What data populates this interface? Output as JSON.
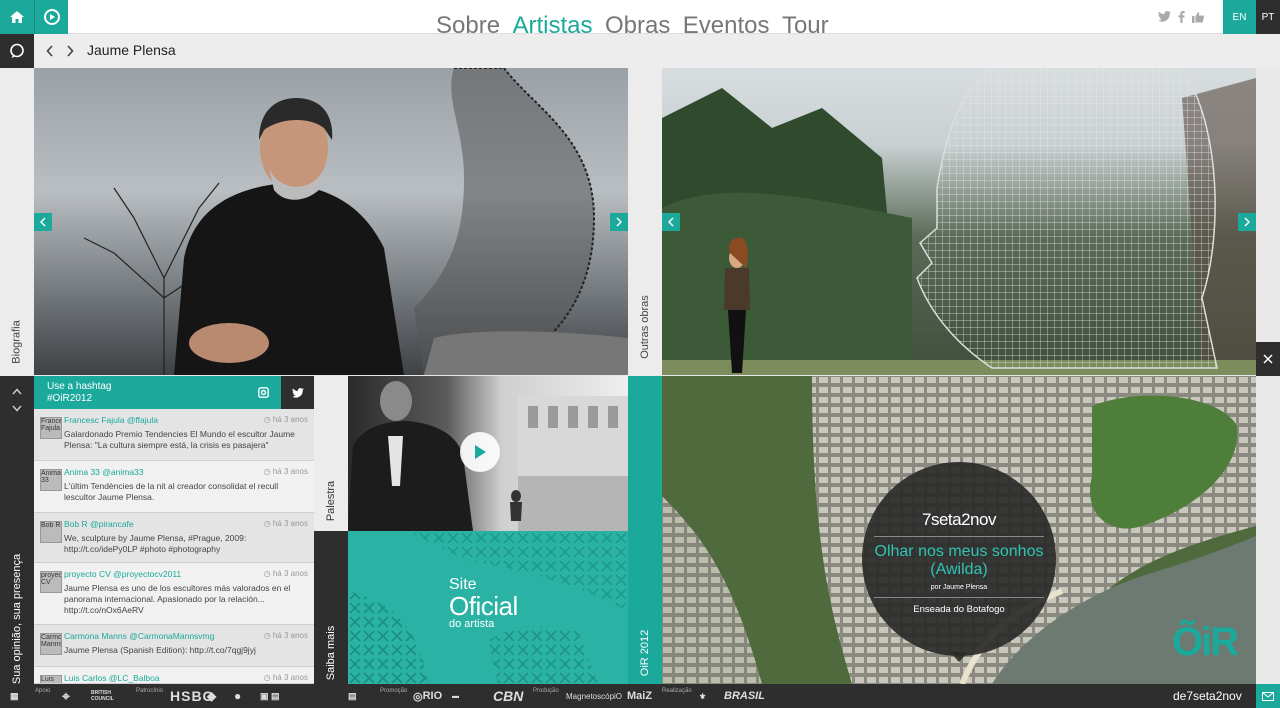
{
  "colors": {
    "accent": "#1aa99a",
    "dark": "#2e2e2e"
  },
  "topbar": {
    "home_icon": "home-icon",
    "play_icon": "play-icon",
    "nav": [
      {
        "label": "Sobre"
      },
      {
        "label": "Artistas",
        "active": true
      },
      {
        "label": "Obras"
      },
      {
        "label": "Eventos"
      },
      {
        "label": "Tour"
      }
    ],
    "social": [
      "twitter-icon",
      "facebook-icon",
      "like-icon"
    ],
    "lang": [
      "EN",
      "PT"
    ]
  },
  "subbar": {
    "title": "Jaume Plensa"
  },
  "sidetabs": {
    "biografia": "Biografia",
    "outras_obras": "Outras obras",
    "opiniao": "Sua opinião, sua presença",
    "palestra": "Palestra",
    "saiba_mais": "Saiba mais",
    "oir": "OiR 2012"
  },
  "hashtag": {
    "line1": "Use a hashtag",
    "line2": "#OiR2012"
  },
  "tweets": [
    {
      "avatar": "Francesc Fajula",
      "user": "Francesc Fajula @ffajula",
      "time": "há 3 anos",
      "text": "Galardonado Premio Tendencies El Mundo el escultor Jaume Plensa: \"La cultura siempre está, la crisis es pasajera\""
    },
    {
      "avatar": "Anima 33",
      "user": "Anima 33 @anima33",
      "time": "há 3 anos",
      "text": "L'últim Tendències de la nit al creador consolidat el recull lescultor Jaume Plensa."
    },
    {
      "avatar": "Bob R",
      "user": "Bob R @pirancafe",
      "time": "há 3 anos",
      "text": "We, sculpture by Jaume Plensa, #Prague, 2009: http://t.co/idePy0LP #photo #photography"
    },
    {
      "avatar": "proyecto CV",
      "user": "proyecto CV @proyectocv2011",
      "time": "há 3 anos",
      "text": "Jaume Plensa es uno de los escultores más valorados en el panorama internacional. Apasionado por la relación... http://t.co/nOx6AeRV"
    },
    {
      "avatar": "Carmona Manns",
      "user": "Carmona Manns @CarmonaMannsvmg",
      "time": "há 3 anos",
      "text": "Jaume Plensa (Spanish Edition): http://t.co/7qgj9jyj"
    },
    {
      "avatar": "Luis Carlos",
      "user": "Luis Carlos @LC_Balboa",
      "time": "há 3 anos",
      "text": ""
    }
  ],
  "site_oficial": {
    "line1": "Site",
    "line2": "Oficial",
    "line3": "do artista"
  },
  "event": {
    "dates": "7seta2nov",
    "title": "Olhar nos meus sonhos (Awilda)",
    "by": "por Jaume Plensa",
    "place": "Enseada do Botafogo",
    "logo": "ÕiR"
  },
  "footer": {
    "apoio": "Apoio",
    "patrocinio": "Patrocínio",
    "hsbc": "HSBC",
    "promocao": "Promoção",
    "rio": "RIO",
    "cbn": "CBN",
    "producao": "Produção",
    "magneto": "MagnetoscópiO",
    "maiz": "MaiZ",
    "realizacao": "Realização",
    "brasil": "BRASIL",
    "british": "BRITISH COUNCIL",
    "dates": "de7seta2nov"
  }
}
